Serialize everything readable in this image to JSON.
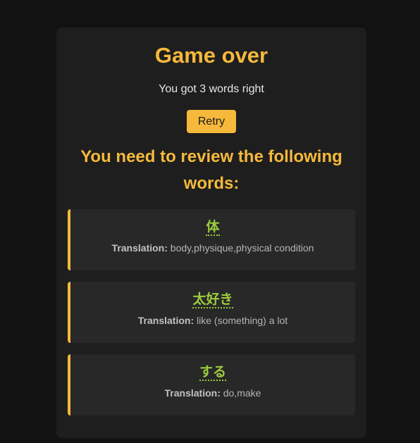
{
  "game": {
    "title": "Game over",
    "score_text": "You got 3 words right",
    "retry_label": "Retry",
    "review_heading": "You need to review the following words:"
  },
  "translation_label": "Translation:",
  "review_words": [
    {
      "word": "体",
      "translation": "body,physique,physical condition"
    },
    {
      "word": "太好き",
      "translation": "like (something) a lot"
    },
    {
      "word": "する",
      "translation": "do,make"
    }
  ],
  "colors": {
    "background": "#121212",
    "card": "#1e1e1e",
    "accent": "#f6b93b",
    "word": "#9ccc3c",
    "word_card": "#282828"
  }
}
